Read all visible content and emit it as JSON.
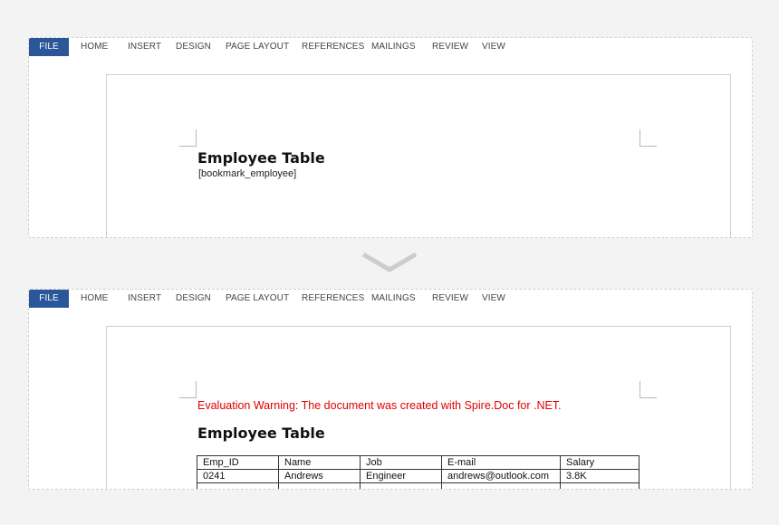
{
  "ribbon": {
    "tabs": [
      "FILE",
      "HOME",
      "INSERT",
      "DESIGN",
      "PAGE LAYOUT",
      "REFERENCES",
      "MAILINGS",
      "REVIEW",
      "VIEW"
    ]
  },
  "before": {
    "title": "Employee Table",
    "bookmark": "[bookmark_employee]"
  },
  "after": {
    "warning": "Evaluation Warning: The document was created with Spire.Doc for .NET.",
    "title": "Employee Table",
    "table": {
      "headers": [
        "Emp_ID",
        "Name",
        "Job",
        "E-mail",
        "Salary"
      ],
      "rows": [
        [
          "0241",
          "Andrews",
          "Engineer",
          "andrews@outlook.com",
          "3.8K"
        ]
      ]
    }
  },
  "colors": {
    "file_tab": "#2b579a",
    "warning": "#e00000"
  }
}
